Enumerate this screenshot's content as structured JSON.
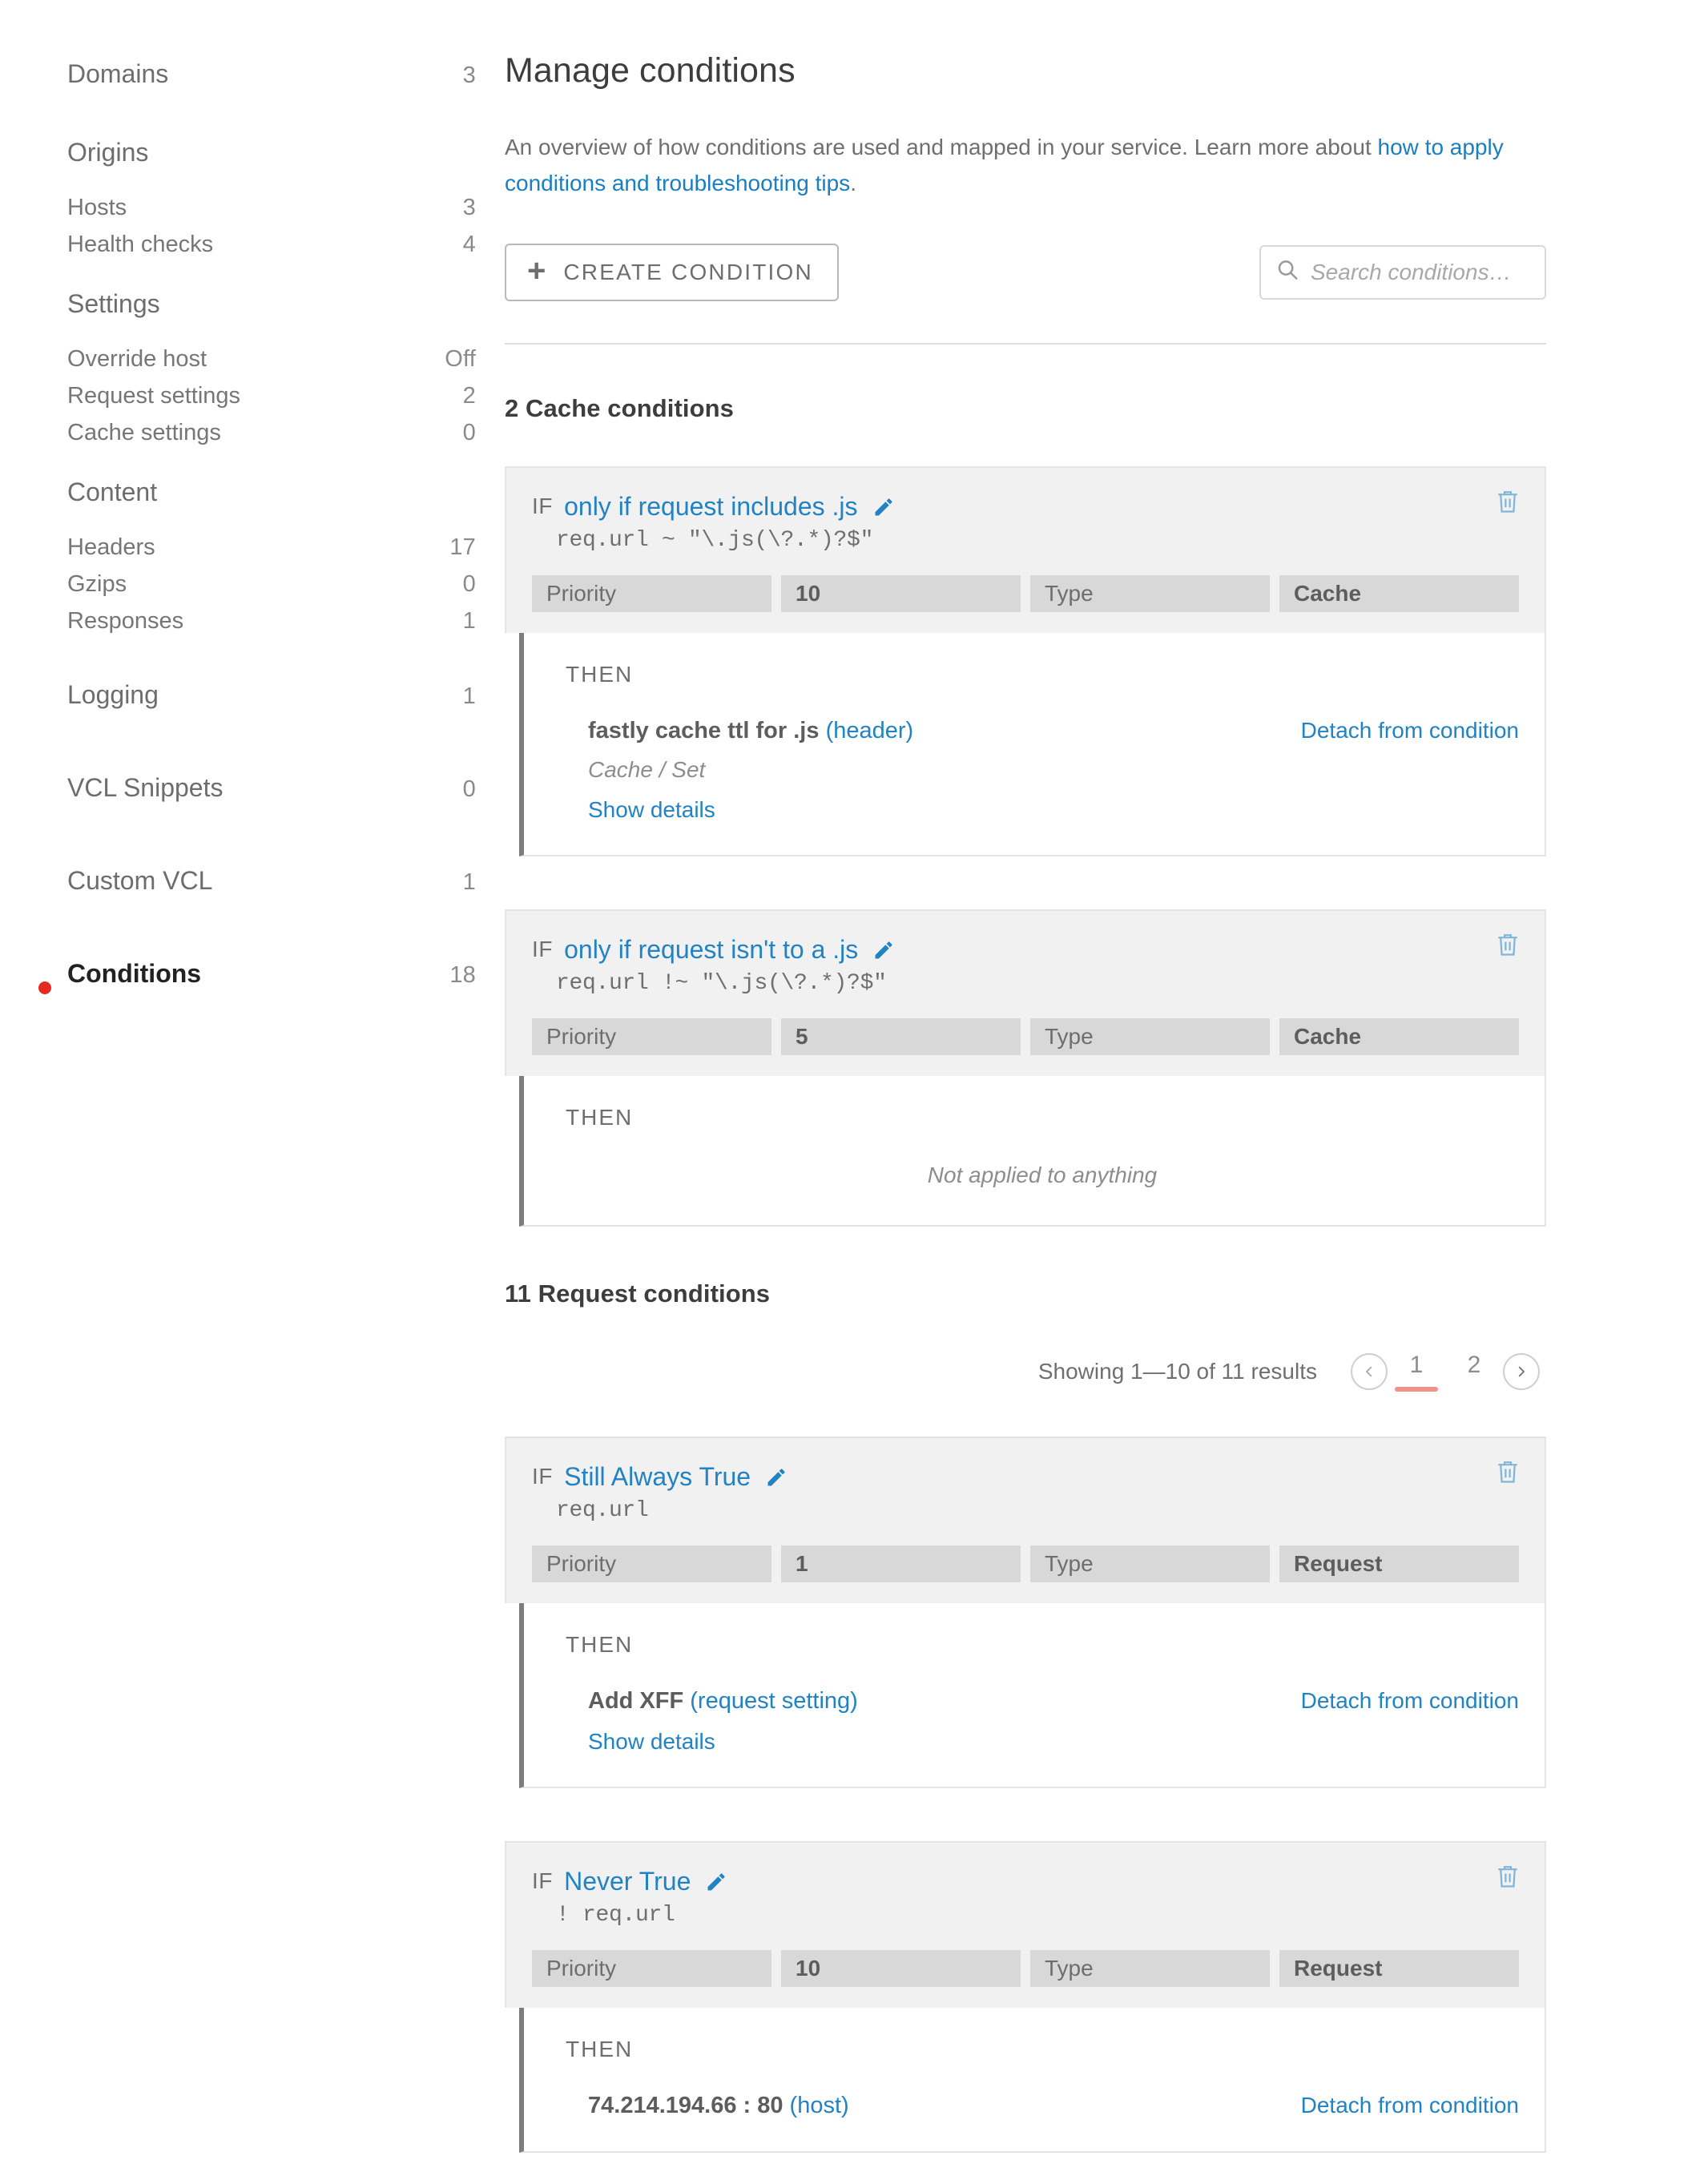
{
  "sidebar": {
    "groups": [
      {
        "heading": {
          "label": "Domains",
          "count": "3",
          "type": "standalone"
        },
        "items": []
      },
      {
        "heading": {
          "label": "Origins",
          "count": "",
          "type": "head"
        },
        "items": [
          {
            "label": "Hosts",
            "count": "3"
          },
          {
            "label": "Health checks",
            "count": "4"
          }
        ]
      },
      {
        "heading": {
          "label": "Settings",
          "count": "",
          "type": "head"
        },
        "items": [
          {
            "label": "Override host",
            "count": "Off"
          },
          {
            "label": "Request settings",
            "count": "2"
          },
          {
            "label": "Cache settings",
            "count": "0"
          }
        ]
      },
      {
        "heading": {
          "label": "Content",
          "count": "",
          "type": "head"
        },
        "items": [
          {
            "label": "Headers",
            "count": "17"
          },
          {
            "label": "Gzips",
            "count": "0"
          },
          {
            "label": "Responses",
            "count": "1"
          }
        ]
      },
      {
        "heading": {
          "label": "Logging",
          "count": "1",
          "type": "standalone"
        },
        "items": []
      },
      {
        "heading": {
          "label": "VCL Snippets",
          "count": "0",
          "type": "standalone"
        },
        "items": []
      },
      {
        "heading": {
          "label": "Custom VCL",
          "count": "1",
          "type": "standalone"
        },
        "items": []
      },
      {
        "heading": {
          "label": "Conditions",
          "count": "18",
          "type": "standalone",
          "active": true
        },
        "items": []
      }
    ]
  },
  "main": {
    "title": "Manage conditions",
    "description_prefix": "An overview of how conditions are used and mapped in your service. Learn more about ",
    "description_link": "how to apply conditions and troubleshooting tips",
    "description_suffix": ".",
    "create_button": "CREATE CONDITION",
    "create_button_icon": "plus-icon",
    "search_placeholder": "Search conditions…",
    "search_value": "",
    "search_icon": "search-icon"
  },
  "cache_section": {
    "title": "2 Cache conditions",
    "cards": [
      {
        "if_label": "IF",
        "name": "only if request includes .js",
        "statement": "req.url ~ \"\\.js(\\?.*)?$\"",
        "chips": [
          {
            "label": "Priority",
            "kind": "label"
          },
          {
            "label": "10",
            "kind": "value"
          },
          {
            "label": "Type",
            "kind": "label"
          },
          {
            "label": "Cache",
            "kind": "value"
          }
        ],
        "then_label": "THEN",
        "attached": {
          "object": "fastly cache ttl for .js",
          "object_kind": "(header)",
          "subtitle": "Cache / Set",
          "show_details": "Show details",
          "detach": "Detach from condition"
        },
        "empty_text": ""
      },
      {
        "if_label": "IF",
        "name": "only if request isn't to a .js",
        "statement": "req.url !~ \"\\.js(\\?.*)?$\"",
        "chips": [
          {
            "label": "Priority",
            "kind": "label"
          },
          {
            "label": "5",
            "kind": "value"
          },
          {
            "label": "Type",
            "kind": "label"
          },
          {
            "label": "Cache",
            "kind": "value"
          }
        ],
        "then_label": "THEN",
        "attached": null,
        "empty_text": "Not applied to anything"
      }
    ]
  },
  "request_section": {
    "title": "11 Request conditions",
    "pagination": {
      "showing": "Showing 1—10 of 11 results",
      "prev_icon": "chevron-left-icon",
      "next_icon": "chevron-right-icon",
      "pages": [
        "1",
        "2"
      ],
      "current": "1"
    },
    "cards": [
      {
        "if_label": "IF",
        "name": "Still Always True",
        "statement": "req.url",
        "chips": [
          {
            "label": "Priority",
            "kind": "label"
          },
          {
            "label": "1",
            "kind": "value"
          },
          {
            "label": "Type",
            "kind": "label"
          },
          {
            "label": "Request",
            "kind": "value"
          }
        ],
        "then_label": "THEN",
        "attached": {
          "object": "Add XFF",
          "object_kind": "(request setting)",
          "subtitle": "",
          "show_details": "Show details",
          "detach": "Detach from condition"
        },
        "empty_text": ""
      },
      {
        "if_label": "IF",
        "name": "Never True",
        "statement": "! req.url",
        "chips": [
          {
            "label": "Priority",
            "kind": "label"
          },
          {
            "label": "10",
            "kind": "value"
          },
          {
            "label": "Type",
            "kind": "label"
          },
          {
            "label": "Request",
            "kind": "value"
          }
        ],
        "then_label": "THEN",
        "attached": {
          "object": "74.214.194.66 : 80",
          "object_kind": "(host)",
          "subtitle": "",
          "show_details": "",
          "detach": "Detach from condition"
        },
        "empty_text": ""
      }
    ]
  },
  "colors": {
    "link": "#2182c4",
    "accent_red": "#e52b1f",
    "pager_underline": "#f29089",
    "chip_bg": "#d8d8d8",
    "card_header_bg": "#f1f1f1",
    "then_bar": "#7d7d7d"
  }
}
